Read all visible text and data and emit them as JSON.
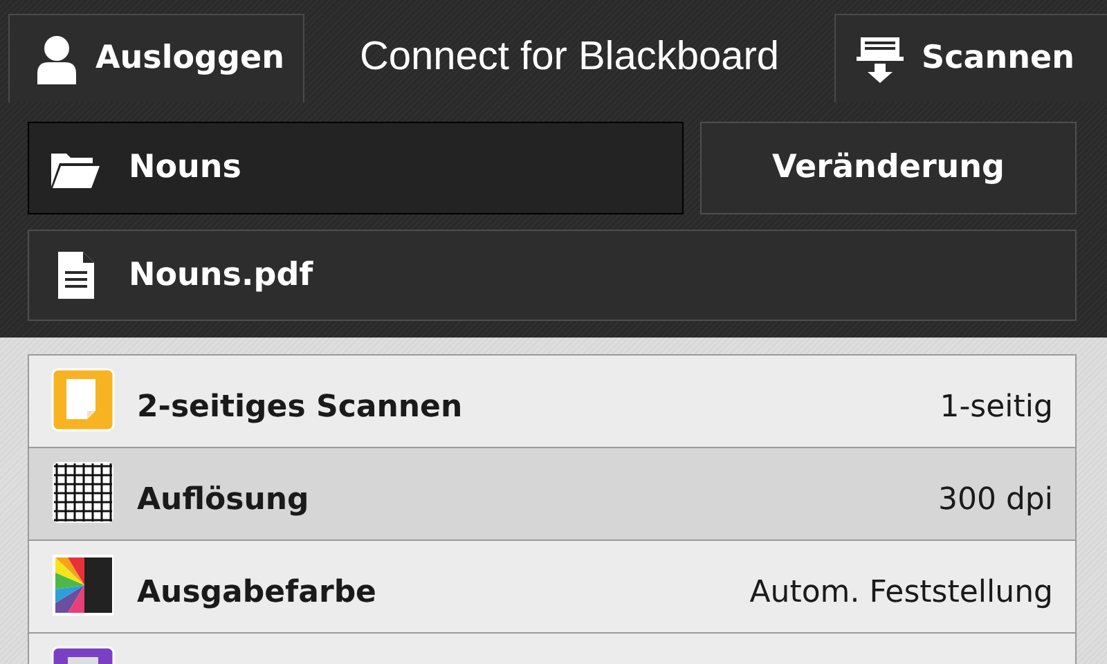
{
  "header": {
    "logout_button": "Ausloggen",
    "title": "Connect for Blackboard",
    "scan_button": "Scannen"
  },
  "destination": {
    "folder": "Nouns",
    "change_button": "Veränderung"
  },
  "file": {
    "name": "Nouns.pdf"
  },
  "settings": [
    {
      "kind": "sides",
      "label": "2-seitiges Scannen",
      "value": "1-seitig",
      "selected": false
    },
    {
      "kind": "resolution",
      "label": "Auflösung",
      "value": "300 dpi",
      "selected": true
    },
    {
      "kind": "color",
      "label": "Ausgabefarbe",
      "value": "Autom. Feststellung",
      "selected": false
    },
    {
      "kind": "purple"
    }
  ]
}
